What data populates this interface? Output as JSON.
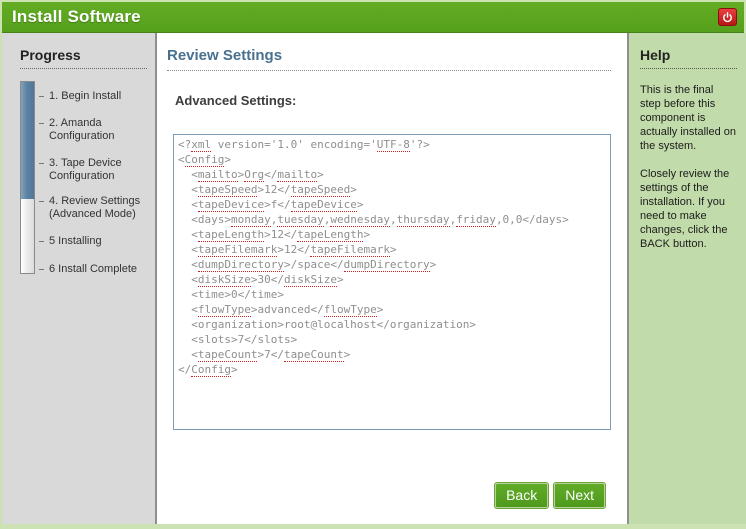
{
  "header": {
    "title": "Install Software"
  },
  "progress": {
    "heading": "Progress",
    "fill_percent": 61,
    "steps": [
      {
        "label": "1. Begin Install"
      },
      {
        "label": "2. Amanda Configuration"
      },
      {
        "label": "3. Tape Device Configuration"
      },
      {
        "label": "4. Review Settings (Advanced Mode)"
      },
      {
        "label": "5 Installing"
      },
      {
        "label": "6 Install Complete"
      }
    ]
  },
  "main": {
    "heading": "Review Settings",
    "subheading": "Advanced Settings:",
    "xml_editor": {
      "lines": [
        "<?xml version='1.0' encoding='UTF-8'?>",
        "<Config>",
        "  <mailto>Org</mailto>",
        "  <tapeSpeed>12</tapeSpeed>",
        "  <tapeDevice>f</tapeDevice>",
        "  <days>monday,tuesday,wednesday,thursday,friday,0,0</days>",
        "  <tapeLength>12</tapeLength>",
        "  <tapeFilemark>12</tapeFilemark>",
        "  <dumpDirectory>/space</dumpDirectory>",
        "  <diskSize>30</diskSize>",
        "  <time>0</time>",
        "  <flowType>advanced</flowType>",
        "  <organization>root@localhost</organization>",
        "  <slots>7</slots>",
        "  <tapeCount>7</tapeCount>",
        "</Config>"
      ],
      "misspelled_words": [
        "xml",
        "UTF-8",
        "Config",
        "mailto",
        "Org",
        "tapeSpeed",
        "tapeDevice",
        "monday",
        "tuesday",
        "wednesday",
        "thursday",
        "friday",
        "tapeLength",
        "tapeFilemark",
        "dumpDirectory",
        "diskSize",
        "flowType",
        "tapeCount"
      ]
    },
    "buttons": {
      "back": "Back",
      "next": "Next"
    }
  },
  "help": {
    "heading": "Help",
    "paragraphs": [
      "This is the final step before this component is actually installed on the system.",
      "Closely review the settings of the installation. If you need to make changes, click the BACK button."
    ]
  },
  "colors": {
    "header_green": "#55a01c",
    "button_green": "#4f9a1d",
    "help_panel_bg": "#c2dbaa",
    "page_border": "#cde2b2",
    "sidebar_bg": "#d9d9d9",
    "progress_fill": "#5b82a3",
    "heading_blue": "#48708f",
    "squiggle_red": "#cc2222",
    "power_button_red": "#b81616",
    "xml_text_gray": "#8f8f8f"
  }
}
